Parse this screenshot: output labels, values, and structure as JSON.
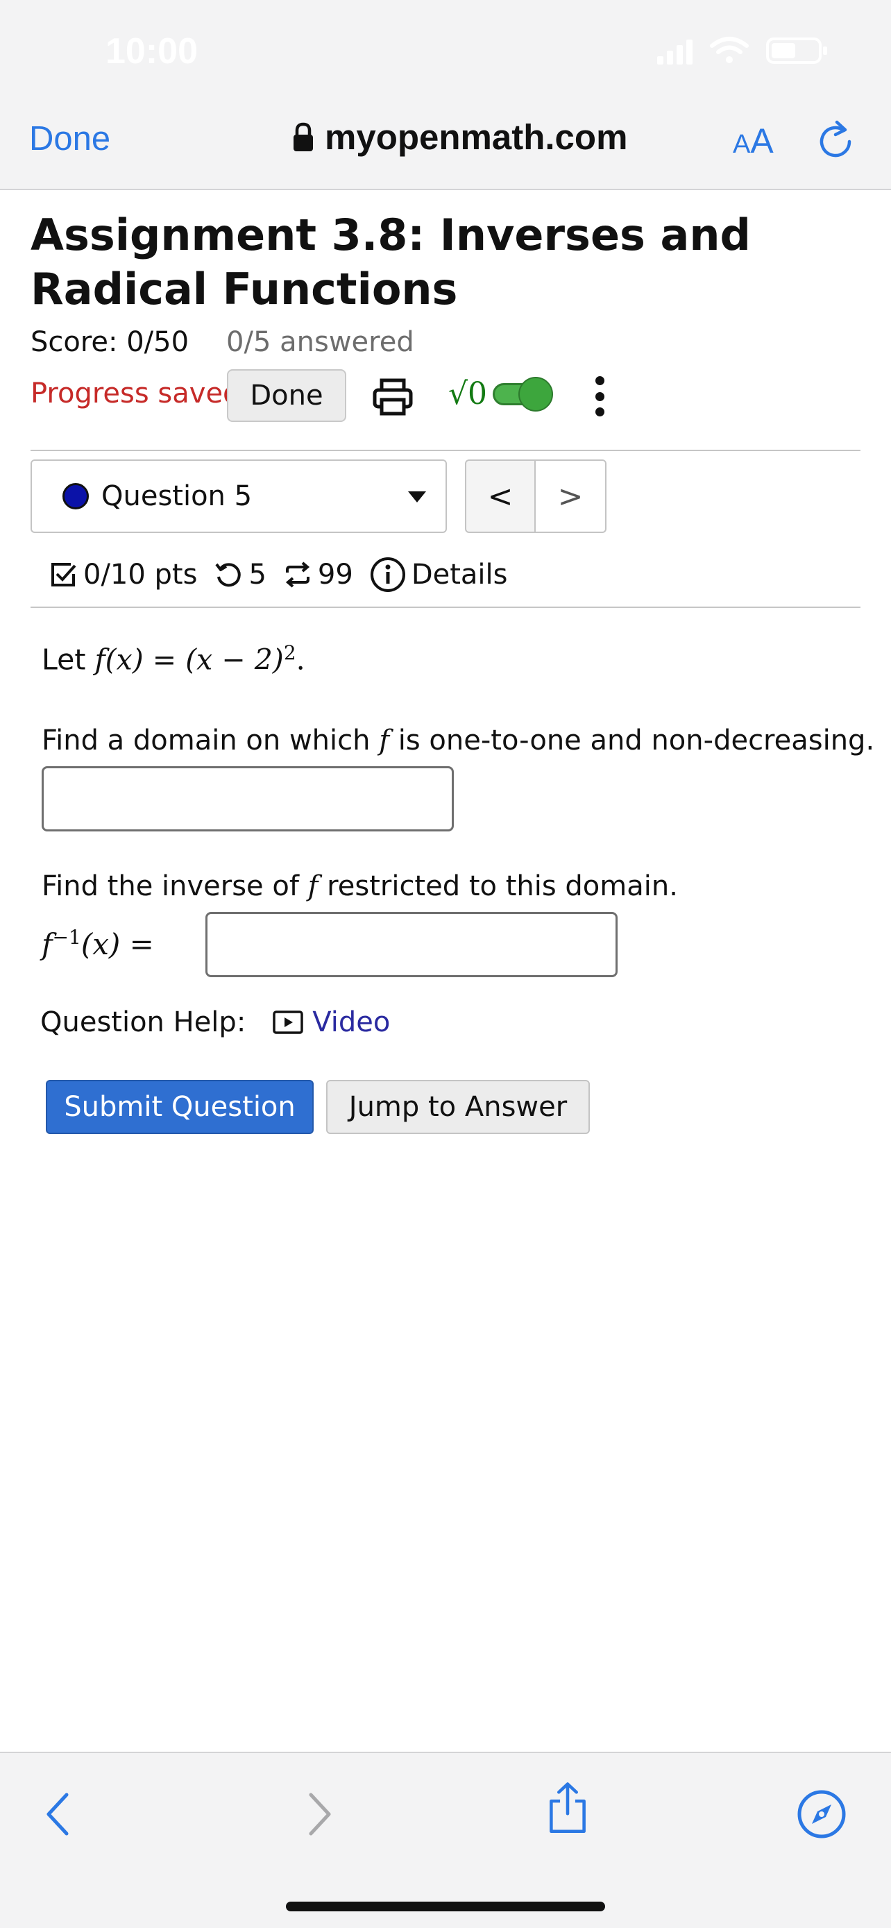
{
  "status_bar": {
    "time": "10:00"
  },
  "browser": {
    "done_label": "Done",
    "host": "myopenmath.com",
    "text_size_small": "A",
    "text_size_big": "A",
    "icons": [
      "lock-icon",
      "reload-icon",
      "back-icon",
      "forward-icon",
      "share-icon",
      "compass-icon"
    ]
  },
  "assignment": {
    "title": "Assignment 3.8: Inverses and Radical Functions",
    "score": "Score: 0/50",
    "answered": "0/5 answered",
    "progress_status": "Progress saved",
    "done_button": "Done",
    "math_toggle_label": "√0"
  },
  "question_nav": {
    "selected_question": "Question 5",
    "prev_symbol": "<",
    "next_symbol": ">"
  },
  "question_meta": {
    "points": "0/10 pts",
    "retries": "5",
    "regens": "99",
    "details": "Details"
  },
  "question": {
    "let_text": "Let",
    "function_def_lhs": "f(x)",
    "function_def_eq": " = ",
    "function_def_rhs": "(x − 2)",
    "function_def_exp": "2",
    "function_def_end": ".",
    "prompt1_pre": "Find a domain on which ",
    "prompt1_var": "f",
    "prompt1_post": " is one-to-one and non-decreasing.",
    "answer1_value": "",
    "prompt2_pre": "Find the inverse of ",
    "prompt2_var": "f",
    "prompt2_post": " restricted to this domain.",
    "inverse_f": "f",
    "inverse_exp": "−1",
    "inverse_arg": "(x)",
    "inverse_eq": " =",
    "answer2_value": ""
  },
  "help": {
    "label": "Question Help:",
    "video": "Video"
  },
  "actions": {
    "submit": "Submit Question",
    "jump": "Jump to Answer"
  },
  "colors": {
    "accent": "#2b78e4",
    "submit": "#2f6fd1",
    "progress_saved": "#c62a28",
    "toggle_on": "#3da63d",
    "question_dot": "#0b12a8"
  }
}
